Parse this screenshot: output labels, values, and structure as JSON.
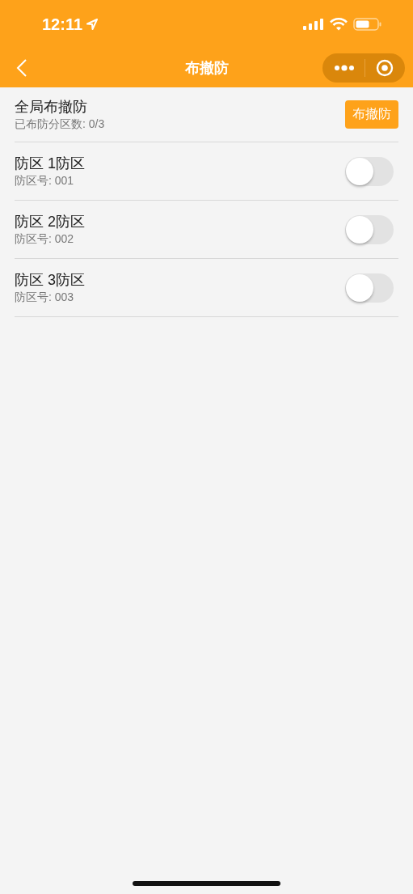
{
  "status_bar": {
    "time": "12:11"
  },
  "nav_bar": {
    "title": "布撤防"
  },
  "global": {
    "title": "全局布撤防",
    "subtitle": "已布防分区数: 0/3",
    "button": "布撤防"
  },
  "zones": [
    {
      "name": "防区 1防区",
      "number": "防区号: 001",
      "on": false
    },
    {
      "name": "防区 2防区",
      "number": "防区号: 002",
      "on": false
    },
    {
      "name": "防区 3防区",
      "number": "防区号: 003",
      "on": false
    }
  ]
}
